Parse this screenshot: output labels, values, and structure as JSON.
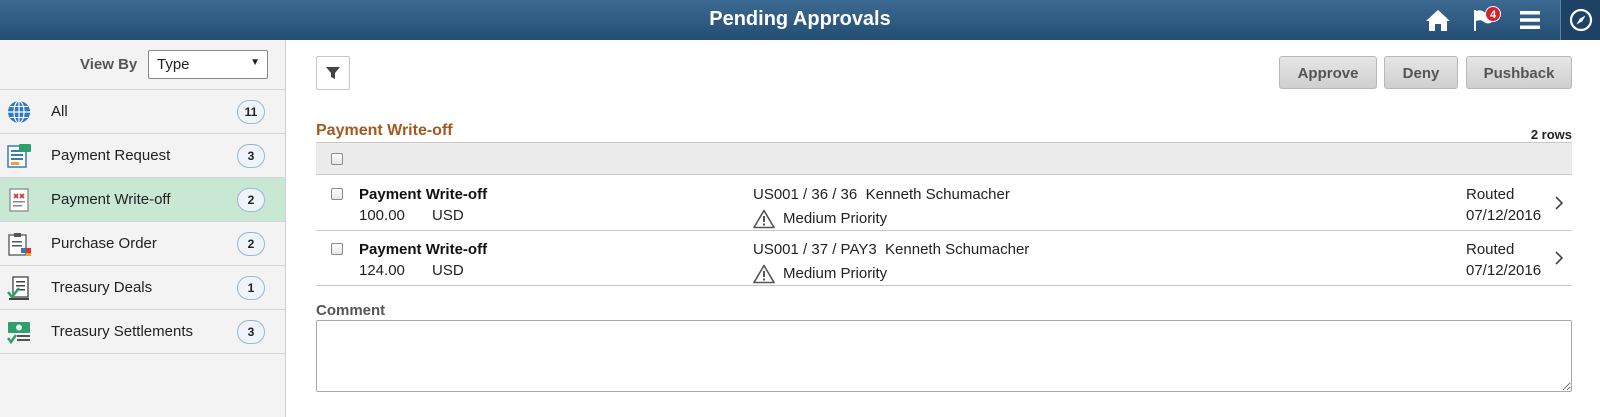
{
  "header": {
    "title": "Pending Approvals",
    "notification_count": "4",
    "icons": [
      "home-icon",
      "flag-icon",
      "menu-icon",
      "navbar-compass-icon"
    ]
  },
  "sidebar": {
    "view_by_label": "View By",
    "view_by_value": "Type",
    "items": [
      {
        "label": "All",
        "count": "11",
        "icon": "globe-icon",
        "selected": false
      },
      {
        "label": "Payment Request",
        "count": "3",
        "icon": "payment-request-icon",
        "selected": false
      },
      {
        "label": "Payment Write-off",
        "count": "2",
        "icon": "payment-write-off-icon",
        "selected": true
      },
      {
        "label": "Purchase Order",
        "count": "2",
        "icon": "purchase-order-icon",
        "selected": false
      },
      {
        "label": "Treasury Deals",
        "count": "1",
        "icon": "treasury-deals-icon",
        "selected": false
      },
      {
        "label": "Treasury Settlements",
        "count": "3",
        "icon": "treasury-settlements-icon",
        "selected": false
      }
    ]
  },
  "toolbar": {
    "approve_label": "Approve",
    "deny_label": "Deny",
    "pushback_label": "Pushback"
  },
  "grid": {
    "title": "Payment Write-off",
    "rows_count": "2 rows",
    "rows": [
      {
        "title": "Payment Write-off",
        "amount": "100.00",
        "currency": "USD",
        "id": "US001 / 36 / 36",
        "requester": "Kenneth Schumacher",
        "priority": "Medium Priority",
        "status": "Routed",
        "date": "07/12/2016"
      },
      {
        "title": "Payment Write-off",
        "amount": "124.00",
        "currency": "USD",
        "id": "US001 / 37 / PAY3",
        "requester": "Kenneth Schumacher",
        "priority": "Medium Priority",
        "status": "Routed",
        "date": "07/12/2016"
      }
    ]
  },
  "comment": {
    "label": "Comment",
    "value": ""
  },
  "colors": {
    "header_bg": "#2c5a82",
    "selected_bg": "#c8e8d4",
    "group_title": "#a35a21",
    "badge": "#d3232a"
  }
}
